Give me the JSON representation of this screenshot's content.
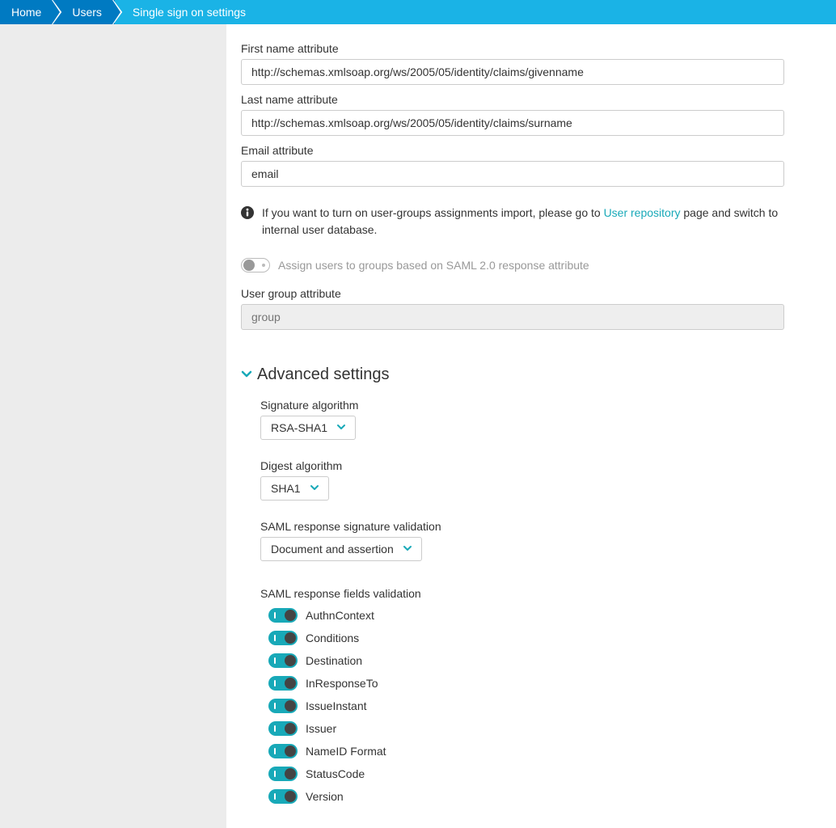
{
  "breadcrumb": {
    "items": [
      "Home",
      "Users",
      "Single sign on settings"
    ]
  },
  "form": {
    "first_name_label": "First name attribute",
    "first_name_value": "http://schemas.xmlsoap.org/ws/2005/05/identity/claims/givenname",
    "last_name_label": "Last name attribute",
    "last_name_value": "http://schemas.xmlsoap.org/ws/2005/05/identity/claims/surname",
    "email_label": "Email attribute",
    "email_value": "email",
    "info_prefix": "If you want to turn on user-groups assignments import, please go to ",
    "info_link": "User repository",
    "info_suffix": " page and switch to internal user database.",
    "assign_toggle_label": "Assign users to groups based on SAML 2.0 response attribute",
    "user_group_label": "User group attribute",
    "user_group_placeholder": "group"
  },
  "advanced": {
    "title": "Advanced settings",
    "signature_label": "Signature algorithm",
    "signature_value": "RSA-SHA1",
    "digest_label": "Digest algorithm",
    "digest_value": "SHA1",
    "sig_validation_label": "SAML response signature validation",
    "sig_validation_value": "Document and assertion",
    "fields_validation_label": "SAML response fields validation",
    "validations": [
      "AuthnContext",
      "Conditions",
      "Destination",
      "InResponseTo",
      "IssueInstant",
      "Issuer",
      "NameID Format",
      "StatusCode",
      "Version"
    ]
  }
}
